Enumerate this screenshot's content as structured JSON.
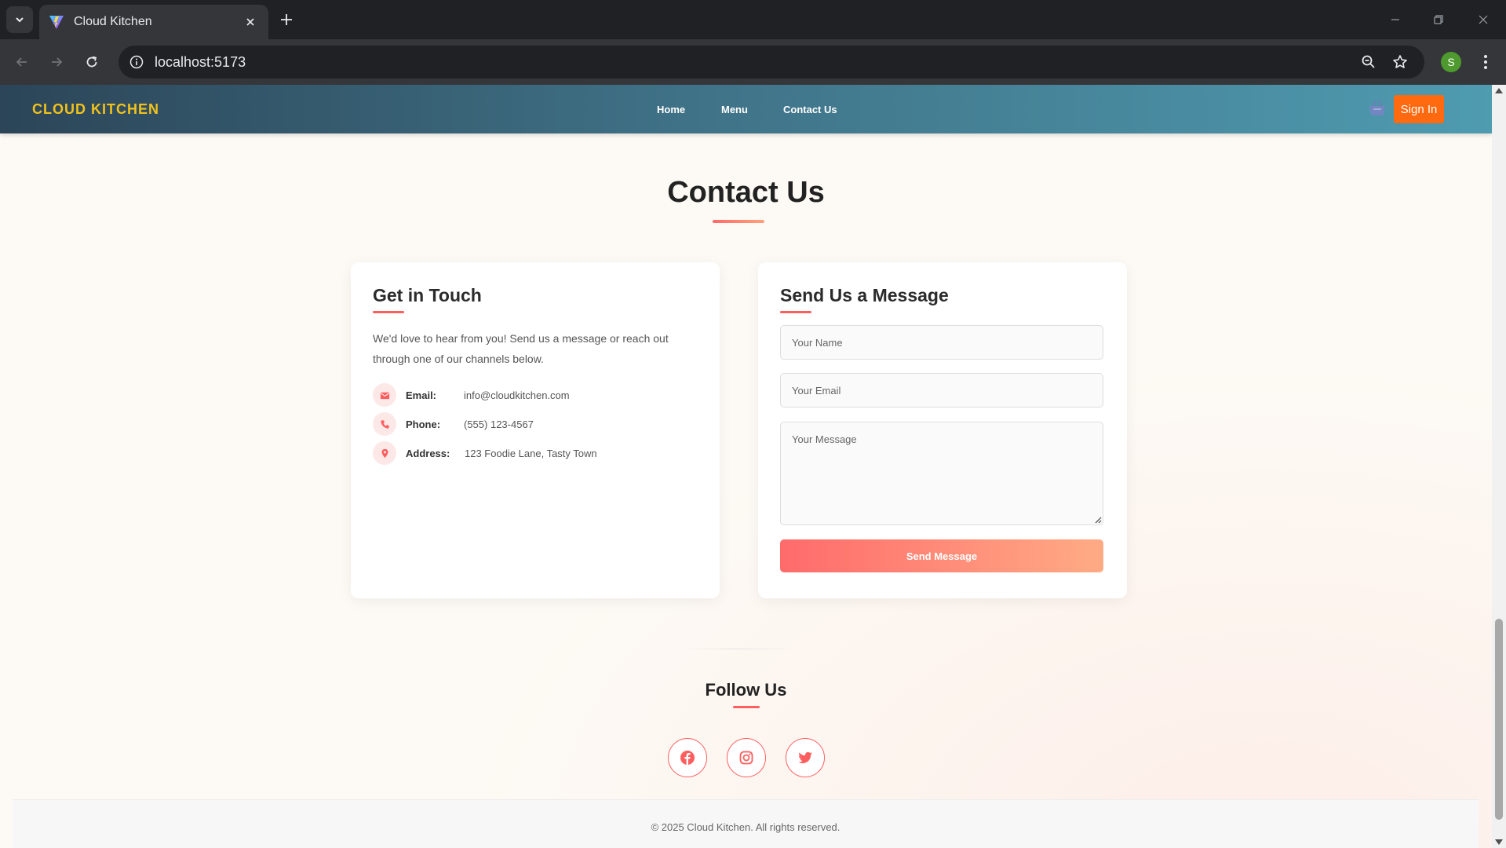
{
  "browser": {
    "tab_title": "Cloud Kitchen",
    "url": "localhost:5173",
    "profile_initial": "S"
  },
  "site": {
    "brand": "CLOUD KITCHEN",
    "nav": {
      "home": "Home",
      "menu": "Menu",
      "contact": "Contact Us"
    },
    "signin_label": "Sign In"
  },
  "page": {
    "title": "Contact Us"
  },
  "contact_info": {
    "heading": "Get in Touch",
    "intro": "We'd love to hear from you! Send us a message or reach out through one of our channels below.",
    "email_label": "Email:",
    "email_value": "info@cloudkitchen.com",
    "phone_label": "Phone:",
    "phone_value": "(555) 123-4567",
    "address_label": "Address:",
    "address_value": "123 Foodie Lane, Tasty Town"
  },
  "contact_form": {
    "heading": "Send Us a Message",
    "name_placeholder": "Your Name",
    "email_placeholder": "Your Email",
    "message_placeholder": "Your Message",
    "submit_label": "Send Message"
  },
  "follow": {
    "heading": "Follow Us",
    "icons": [
      "facebook-icon",
      "instagram-icon",
      "twitter-icon"
    ]
  },
  "footer": {
    "copyright": "© 2025 Cloud Kitchen. All rights reserved."
  },
  "colors": {
    "brand_yellow": "#f2c21b",
    "accent_coral": "#ff5e5e",
    "signin_orange": "#ff6a10",
    "nav_gradient_start": "#2c4558",
    "nav_gradient_end": "#4f9bb0"
  }
}
